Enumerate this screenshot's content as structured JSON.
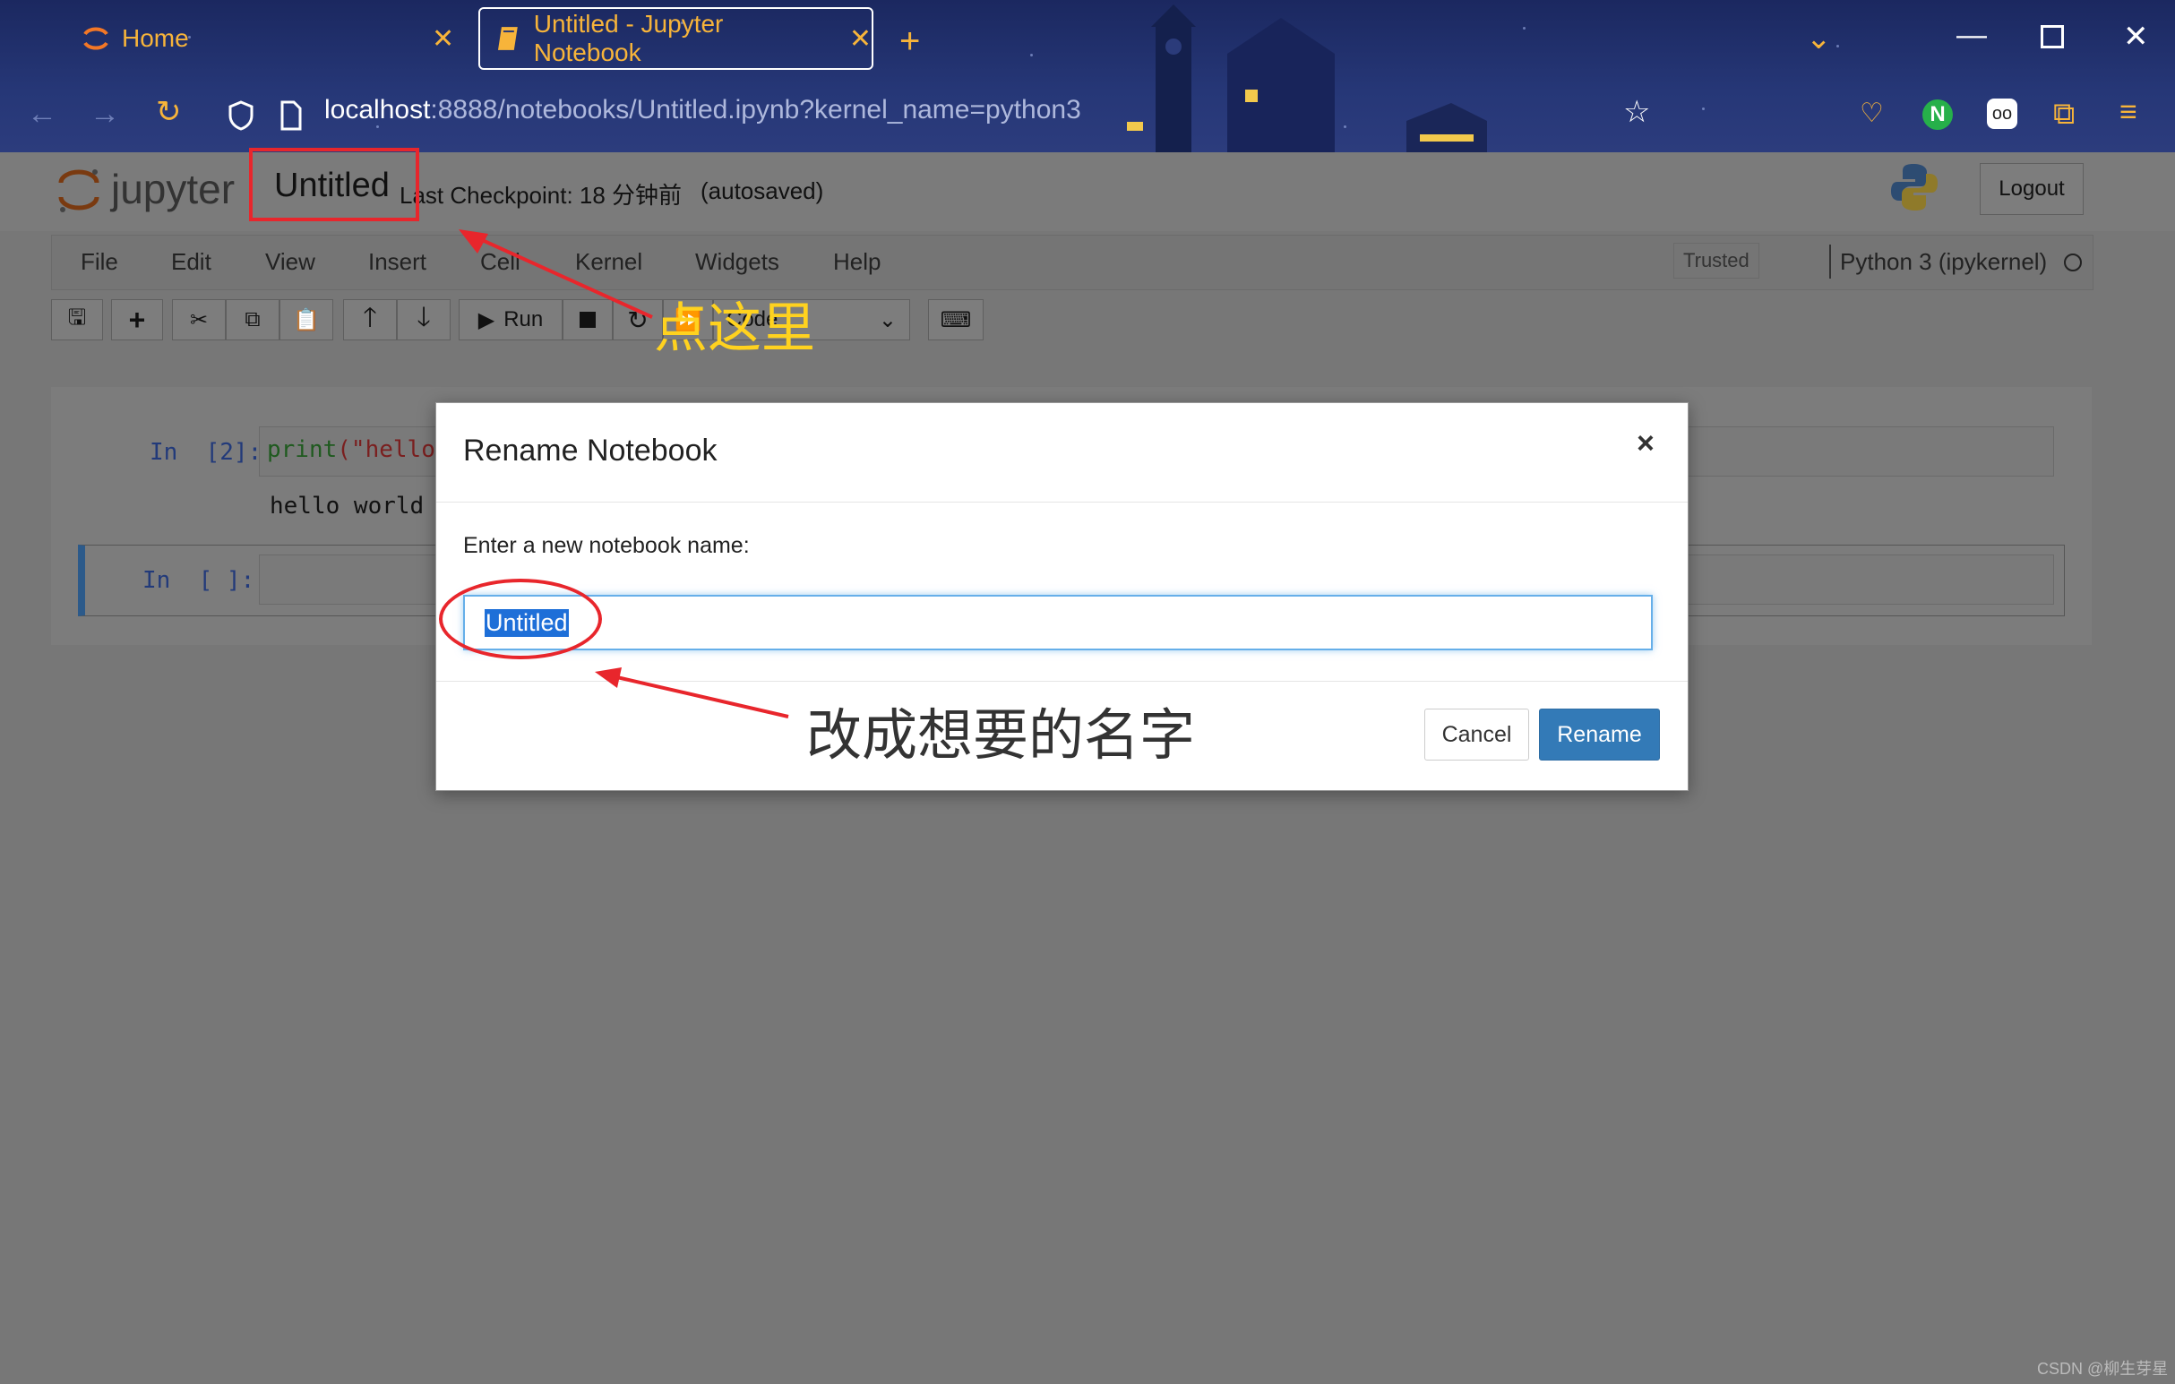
{
  "browser": {
    "tabs": [
      {
        "label": "Home",
        "active": false
      },
      {
        "label": "Untitled - Jupyter Notebook",
        "active": true
      }
    ],
    "url_host": "localhost",
    "url_rest": ":8888/notebooks/Untitled.ipynb?kernel_name=python3"
  },
  "jupyter": {
    "logo_text": "jupyter",
    "notebook_name": "Untitled",
    "checkpoint": "Last Checkpoint: 18 分钟前",
    "autosaved": "(autosaved)",
    "logout_label": "Logout",
    "menu": [
      "File",
      "Edit",
      "View",
      "Insert",
      "Cell",
      "Kernel",
      "Widgets",
      "Help"
    ],
    "trusted_label": "Trusted",
    "kernel_label": "Python 3 (ipykernel)",
    "toolbar": {
      "run_label": "Run",
      "cell_type": "Code"
    },
    "cells": [
      {
        "prompt": "In  [2]:",
        "code_fn": "print",
        "code_str": "(\"hello v",
        "output": "hello world"
      },
      {
        "prompt": "In  [ ]:",
        "code_fn": "",
        "code_str": "",
        "output": ""
      }
    ]
  },
  "modal": {
    "title": "Rename Notebook",
    "close_glyph": "×",
    "label": "Enter a new notebook name:",
    "input_value": "Untitled",
    "cancel_label": "Cancel",
    "rename_label": "Rename"
  },
  "annotations": {
    "click_here": "点这里",
    "change_name": "改成想要的名字"
  },
  "watermark": "CSDN @柳生芽星",
  "colors": {
    "accent_orange": "#f7b43a",
    "primary_blue": "#337ab7",
    "annotation_red": "#e8262c",
    "annotation_yellow": "#ffd21f"
  }
}
